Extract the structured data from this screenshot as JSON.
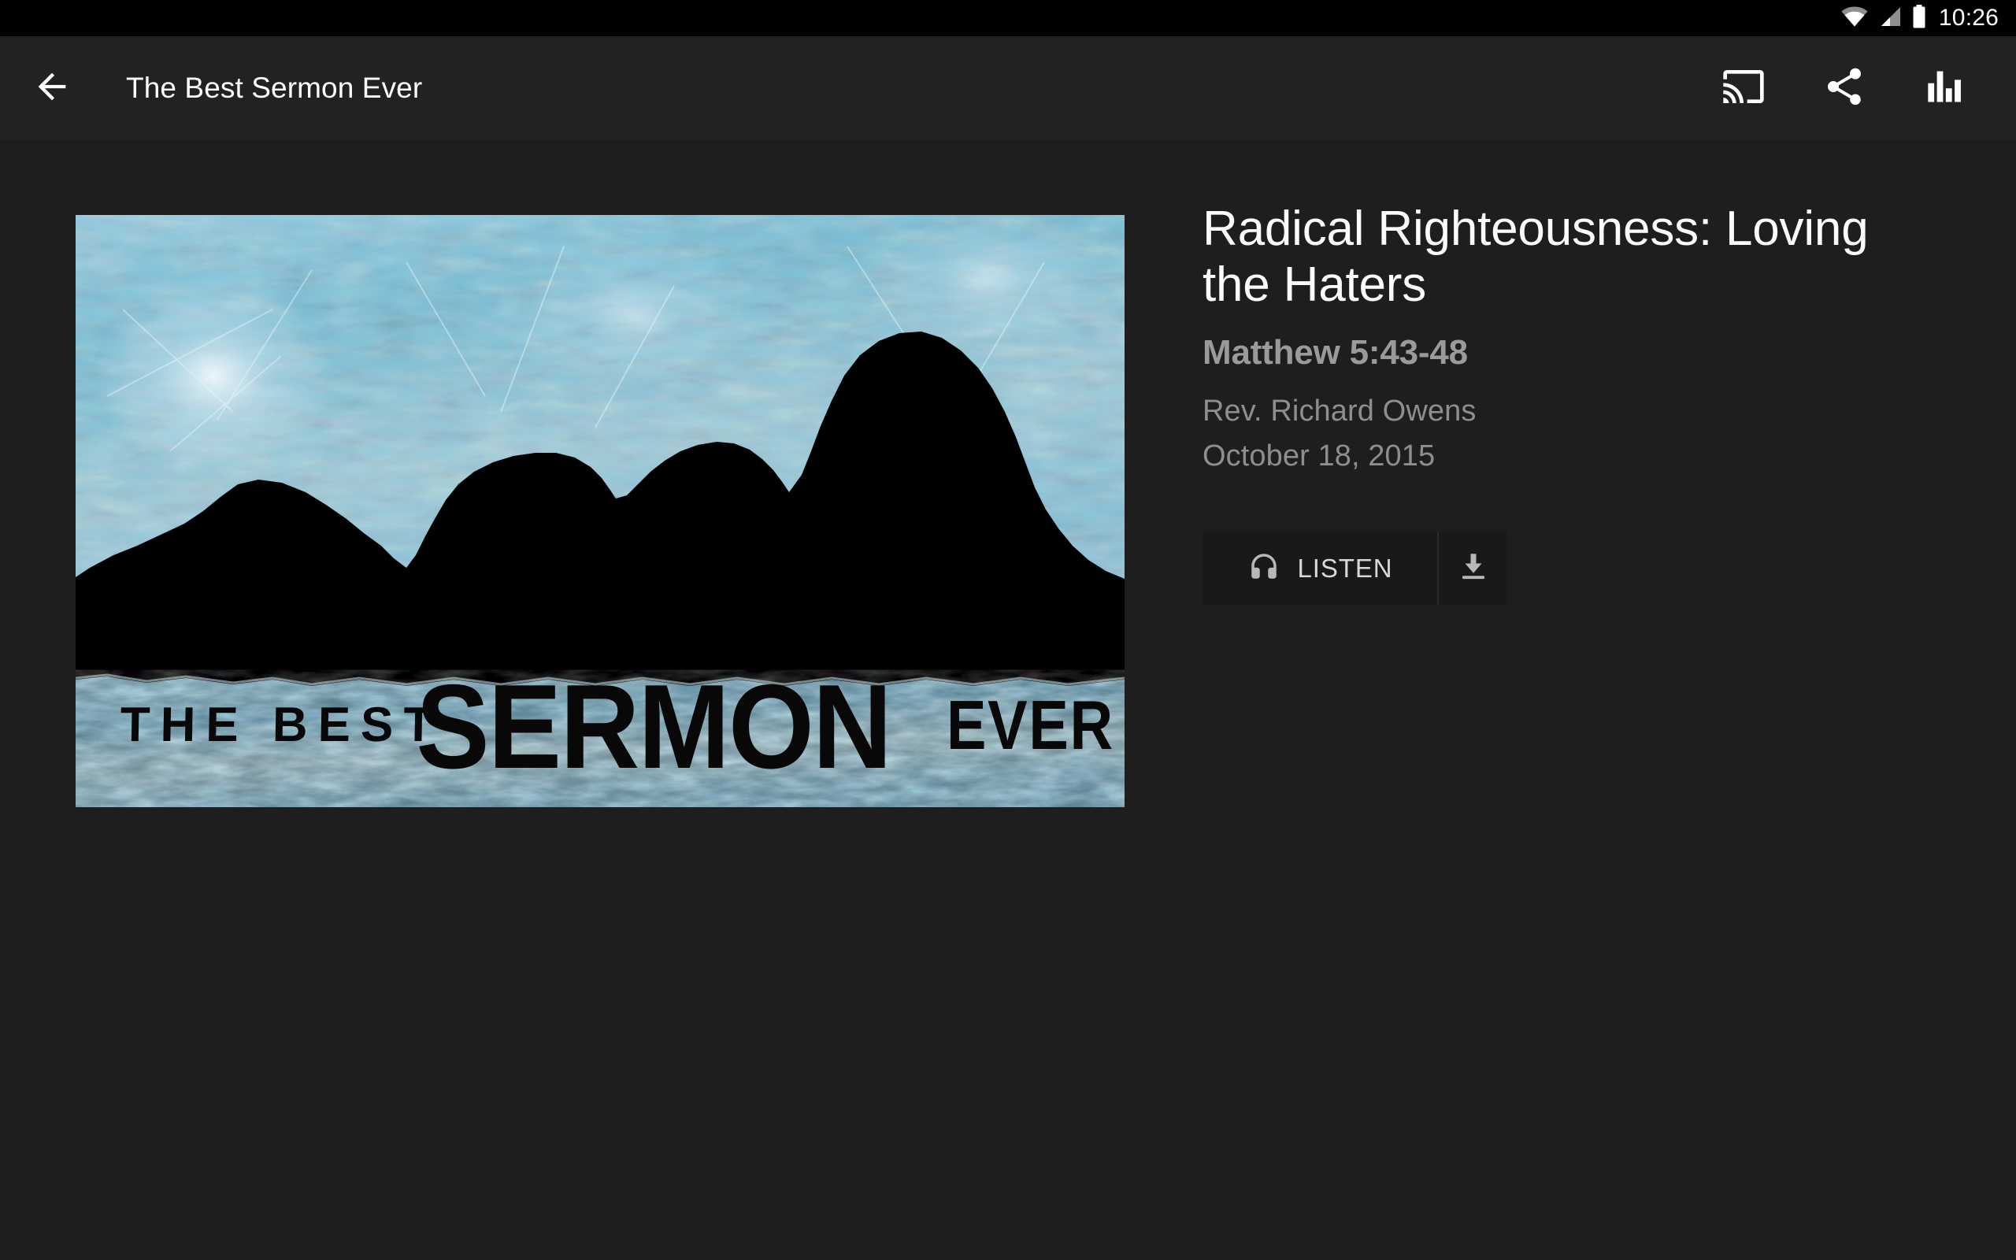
{
  "statusbar": {
    "time": "10:26",
    "icons": [
      "wifi-icon",
      "cellular-signal-icon",
      "battery-icon"
    ]
  },
  "appbar": {
    "back_icon": "back-arrow-icon",
    "title": "The Best Sermon Ever",
    "actions": [
      {
        "name": "cast-icon",
        "label": "Cast"
      },
      {
        "name": "share-icon",
        "label": "Share"
      },
      {
        "name": "equalizer-icon",
        "label": "Equalizer"
      }
    ]
  },
  "artwork": {
    "series_text_small": "THE BEST",
    "series_text_large": "SERMON",
    "series_text_end": "EVER",
    "colors": {
      "sky_light": "#bfe0ec",
      "sky_mid": "#7ec2da",
      "sky_deep": "#5aa9c7",
      "silhouette": "#000000",
      "texture_highlight": "#d9eaf2"
    }
  },
  "detail": {
    "title": "Radical Righteousness: Loving the Haters",
    "scripture": "Matthew 5:43-48",
    "speaker": "Rev. Richard Owens",
    "date": "October 18, 2015",
    "listen_label": "LISTEN",
    "listen_icon": "headphones-icon",
    "download_icon": "download-icon"
  },
  "theme": {
    "status_bg": "#000000",
    "appbar_bg": "#222222",
    "page_bg": "#1e1e1e",
    "button_bg": "#191919",
    "text_primary": "#fbfbfb",
    "text_secondary": "#9a9a9a",
    "text_tertiary": "#8e8e8e"
  }
}
